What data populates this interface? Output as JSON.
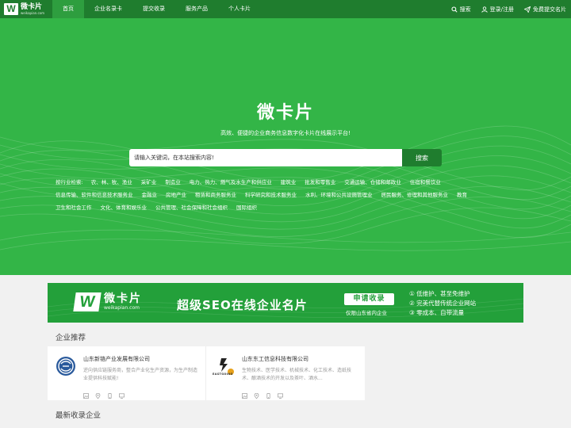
{
  "nav": {
    "logo_cn": "微卡片",
    "logo_en": "weikapian.com",
    "items": [
      "首页",
      "企业名录卡",
      "提交收录",
      "服务产品",
      "个人卡片"
    ],
    "active_index": 0,
    "search_label": "搜索",
    "login_label": "登录/注册",
    "submit_label": "免费提交名片"
  },
  "hero": {
    "title": "微卡片",
    "subtitle": "高效、便捷的企业商务信息数字化卡片在线展示平台!",
    "search_placeholder": "请输入关键词，在本站搜索内容!",
    "search_button": "搜索",
    "industry_label": "按行业检索:",
    "industries": [
      "农、林、牧、渔业",
      "采矿业",
      "制造业",
      "电力、热力、燃气及水生产和供应业",
      "建筑业",
      "批发和零售业",
      "交通运输、仓储和邮政业",
      "住宿和餐饮业",
      "信息传输、软件和信息技术服务业",
      "金融业",
      "房地产业",
      "租赁和商务服务业",
      "科学研究和技术服务业",
      "水利、环境和公共设施管理业",
      "居民服务、修理和其他服务业",
      "教育",
      "卫生和社会工作",
      "文化、体育和娱乐业",
      "公共管理、社会保障和社会组织",
      "国际组织"
    ]
  },
  "banner": {
    "logo_cn": "微卡片",
    "logo_en": "weikapian.com",
    "slogan": "超级SEO在线企业名片",
    "apply": "申请收录",
    "note": "仅限山东省内企业",
    "points": [
      "① 低维护、甚至免维护",
      "② 完美代替传统企业网站",
      "③ 零成本、自带流量"
    ]
  },
  "recommend": {
    "title": "企业推荐",
    "cards": [
      {
        "name": "山东新铬产业发展有限公司",
        "desc": "逆向供应链服务商，整合产业化生产资源，为生产制造业提供科技赋能!"
      },
      {
        "name": "山东东工信息科技有限公司",
        "logo_text": "EASTGOING",
        "desc": "生物技术、医学技术、机械技术、化工技术、造纸技术、酿酒技术的开发以及茶叶、酒水..."
      }
    ]
  },
  "latest": {
    "title": "最新收录企业"
  }
}
